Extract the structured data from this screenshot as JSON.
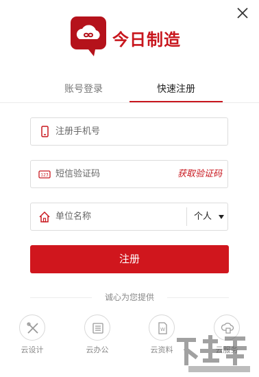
{
  "brand": {
    "name": "今日制造"
  },
  "tabs": [
    {
      "label": "账号登录",
      "active": false
    },
    {
      "label": "快速注册",
      "active": true
    }
  ],
  "form": {
    "phone_placeholder": "注册手机号",
    "code_placeholder": "短信验证码",
    "get_code_label": "获取验证码",
    "unit_placeholder": "单位名称",
    "account_type": "个人",
    "submit_label": "注册"
  },
  "slogan": "诚心为您提供",
  "services": [
    {
      "label": "云设计",
      "icon": "design-tools-icon"
    },
    {
      "label": "云办公",
      "icon": "office-list-icon"
    },
    {
      "label": "云资料",
      "icon": "document-icon"
    },
    {
      "label": "云服务",
      "icon": "cloud-service-icon"
    }
  ],
  "colors": {
    "accent": "#c8161d",
    "button": "#d0161d"
  }
}
